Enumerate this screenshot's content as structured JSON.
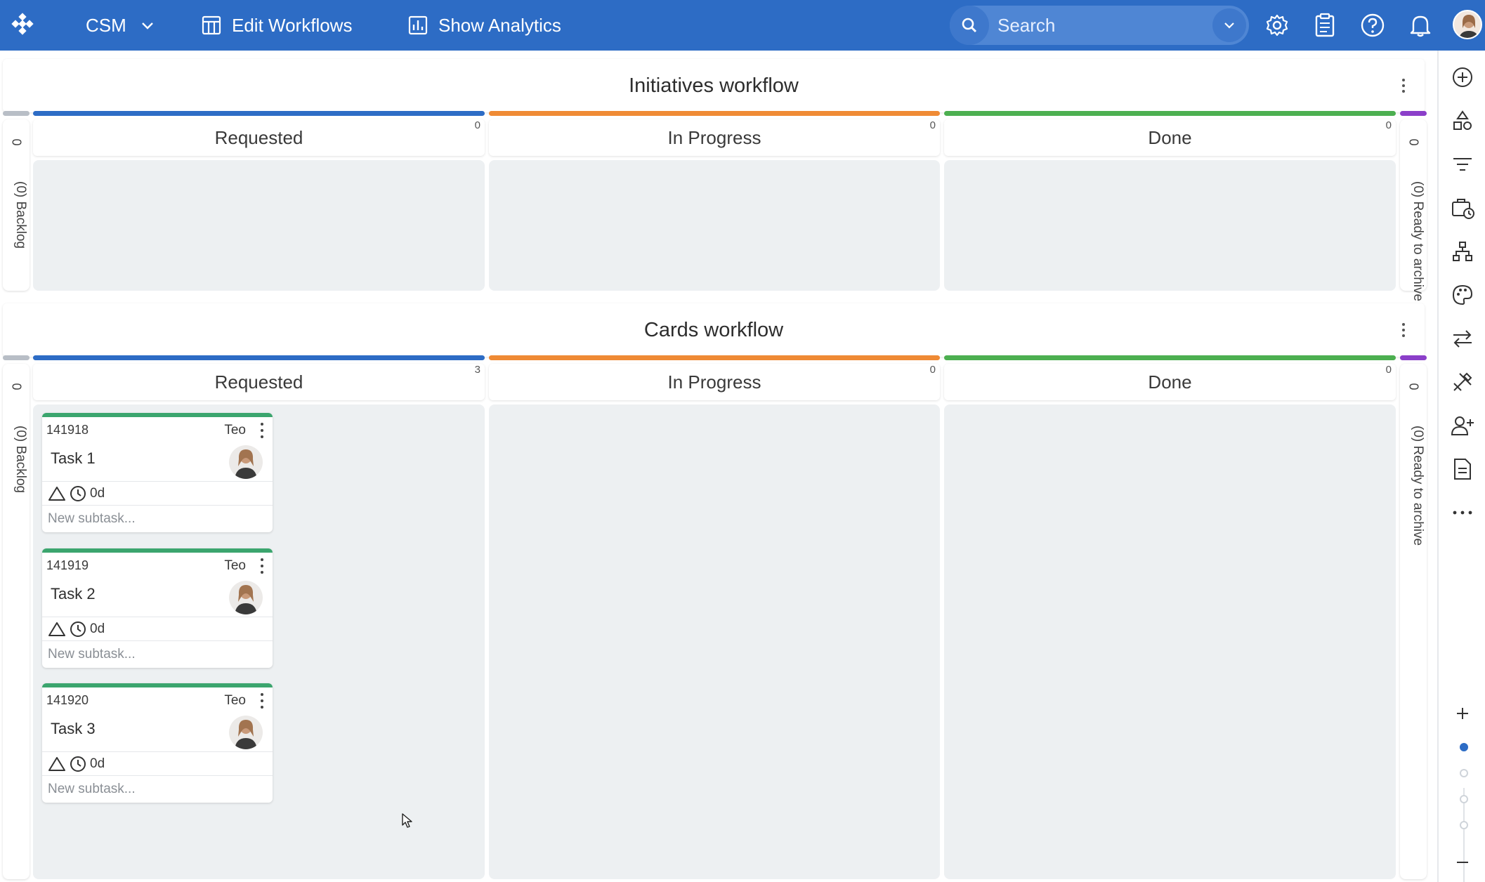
{
  "topbar": {
    "workspace": "CSM",
    "edit_workflows": "Edit Workflows",
    "show_analytics": "Show Analytics",
    "search_placeholder": "Search",
    "brand_color": "#2d6cc5"
  },
  "boards": {
    "initiatives": {
      "title": "Initiatives workflow",
      "backlog": {
        "count": "0",
        "label": "(0) Backlog"
      },
      "archive": {
        "count": "0",
        "label": "(0) Ready to archive"
      },
      "columns": [
        {
          "name": "Requested",
          "count": "0",
          "color": "#2d6cc5"
        },
        {
          "name": "In Progress",
          "count": "0",
          "color": "#ef8a34"
        },
        {
          "name": "Done",
          "count": "0",
          "color": "#4caf50"
        }
      ]
    },
    "cards_wf": {
      "title": "Cards workflow",
      "backlog": {
        "count": "0",
        "label": "(0) Backlog"
      },
      "archive": {
        "count": "0",
        "label": "(0) Ready to archive"
      },
      "columns": [
        {
          "name": "Requested",
          "count": "3",
          "color": "#2d6cc5"
        },
        {
          "name": "In Progress",
          "count": "0",
          "color": "#ef8a34"
        },
        {
          "name": "Done",
          "count": "0",
          "color": "#4caf50"
        }
      ]
    }
  },
  "cards": [
    {
      "id": "141918",
      "owner": "Teo",
      "title": "Task 1",
      "time": "0d",
      "subtask_placeholder": "New subtask..."
    },
    {
      "id": "141919",
      "owner": "Teo",
      "title": "Task 2",
      "time": "0d",
      "subtask_placeholder": "New subtask..."
    },
    {
      "id": "141920",
      "owner": "Teo",
      "title": "Task 3",
      "time": "0d",
      "subtask_placeholder": "New subtask..."
    }
  ],
  "rail_icons": [
    "add-icon",
    "shapes-icon",
    "filter-icon",
    "briefcase-clock-icon",
    "hierarchy-icon",
    "palette-icon",
    "swap-icon",
    "tools-icon",
    "add-user-icon",
    "document-icon",
    "more-icon"
  ],
  "zoom": {
    "plus": "+",
    "minus": "−",
    "level": 1,
    "levels": 4
  }
}
